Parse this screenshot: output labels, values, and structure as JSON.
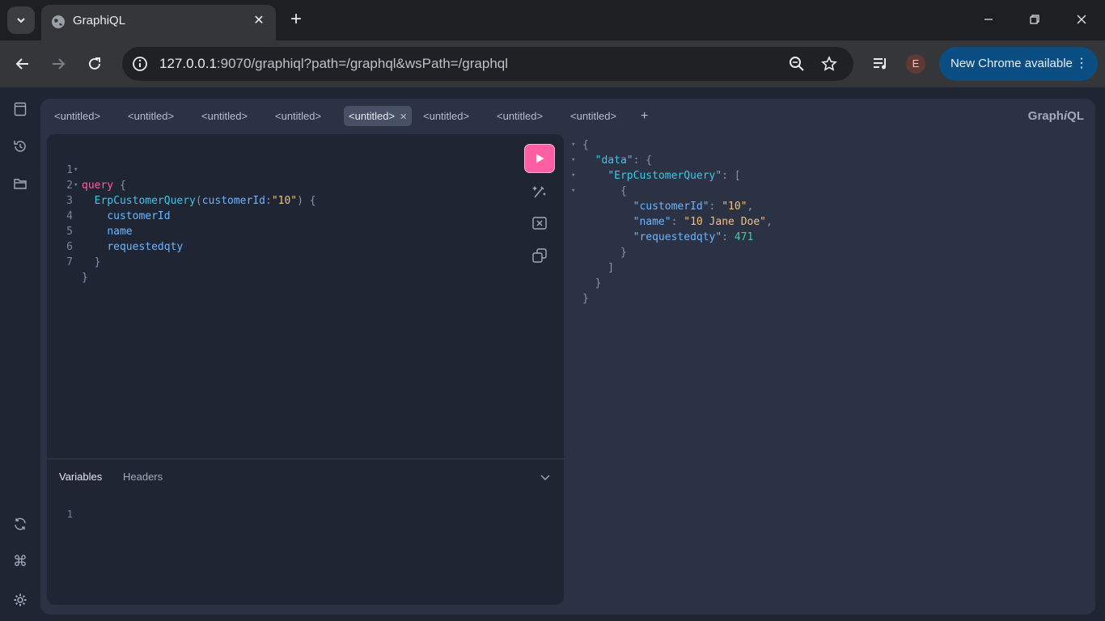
{
  "browser": {
    "tab_title": "GraphiQL",
    "url_host": "127.0.0.1",
    "url_rest": ":9070/graphiql?path=/graphql&wsPath=/graphql",
    "profile_initial": "E",
    "update_label": "New Chrome available"
  },
  "graphiql": {
    "brand_prefix": "Graph",
    "brand_italic": "i",
    "brand_suffix": "QL",
    "tabs": [
      {
        "label": "<untitled>"
      },
      {
        "label": "<untitled>"
      },
      {
        "label": "<untitled>"
      },
      {
        "label": "<untitled>"
      },
      {
        "label": "<untitled>"
      },
      {
        "label": "<untitled>"
      },
      {
        "label": "<untitled>"
      },
      {
        "label": "<untitled>"
      }
    ],
    "active_tab_index": 4,
    "add_tab": "+",
    "editor": {
      "line_numbers": [
        "1",
        "2",
        "3",
        "4",
        "5",
        "6",
        "7"
      ],
      "query_keyword": "query",
      "operation_name": "ErpCustomerQuery",
      "argument_name": "customerId",
      "argument_value": "\"10\"",
      "fields": [
        "customerId",
        "name",
        "requestedqty"
      ]
    },
    "variables": {
      "tab_variables": "Variables",
      "tab_headers": "Headers",
      "line_number": "1"
    },
    "result": {
      "data_key": "\"data\"",
      "query_key": "\"ErpCustomerQuery\"",
      "rows": [
        {
          "key": "\"customerId\"",
          "value": "\"10\"",
          "type": "string"
        },
        {
          "key": "\"name\"",
          "value": "\"10 Jane Doe\"",
          "type": "string"
        },
        {
          "key": "\"requestedqty\"",
          "value": "471",
          "type": "number"
        }
      ]
    }
  },
  "colors": {
    "accent": "#ff5fa2",
    "keyword": "#ff5fa2",
    "operation": "#45c3e6",
    "field": "#6cb6ff",
    "string": "#f5c27a",
    "number": "#34d399",
    "update_pill": "#0b4e83"
  },
  "icons": {
    "sidebar_top": [
      "docs-icon",
      "history-icon",
      "folder-icon"
    ],
    "sidebar_bottom": [
      "refresh-icon",
      "command-icon",
      "gear-icon"
    ],
    "editor_tools": [
      "prettify-icon",
      "merge-icon",
      "copy-icon"
    ]
  }
}
